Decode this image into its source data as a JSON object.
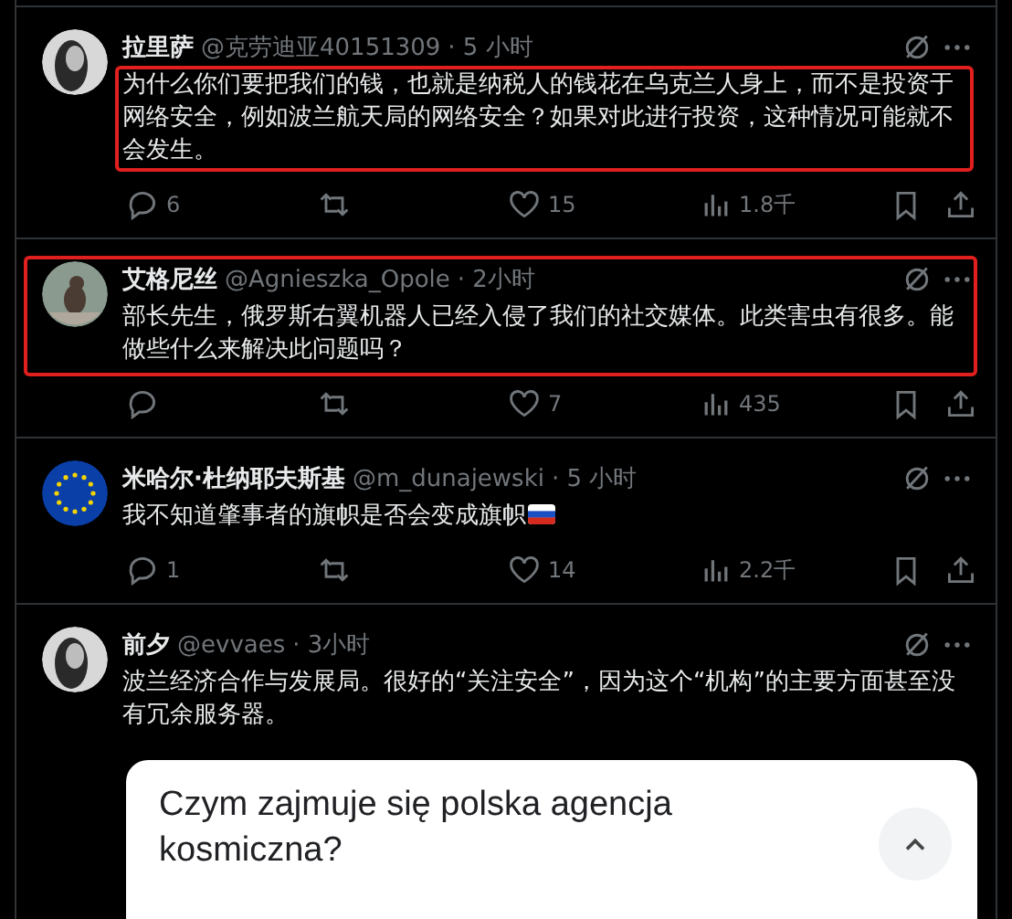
{
  "tweets": [
    {
      "name": "拉里萨",
      "handle": "@克劳迪亚40151309",
      "time": "· 5 小时",
      "text_boxed": true,
      "post_boxed": false,
      "text": "为什么你们要把我们的钱，也就是纳税人的钱花在乌克兰人身上，而不是投资于网络安全，例如波兰航天局的网络安全？如果对此进行投资，这种情况可能就不会发生。",
      "replies": "6",
      "likes": "15",
      "views": "1.8千"
    },
    {
      "name": "艾格尼丝",
      "handle": "@Agnieszka_Opole",
      "time": "· 2小时",
      "text_boxed": false,
      "post_boxed": true,
      "text": "部长先生，俄罗斯右翼机器人已经入侵了我们的社交媒体。此类害虫有很多。能做些什么来解决此问题吗？",
      "likes": "7",
      "views": "435"
    },
    {
      "name": "米哈尔·杜纳耶夫斯基",
      "handle": "@m_dunajewski",
      "time": "· 5 小时",
      "text_boxed": false,
      "post_boxed": false,
      "text": "我不知道肇事者的旗帜是否会变成旗帜",
      "flag_emoji": true,
      "replies": "1",
      "likes": "14",
      "views": "2.2千"
    },
    {
      "name": "前夕",
      "handle": "@evvaes",
      "time": "· 3小时",
      "text_boxed": false,
      "post_boxed": false,
      "text": "波兰经济合作与发展局。很好的“关注安全”，因为这个“机构”的主要方面甚至没有冗余服务器。",
      "card": {
        "question": "Czym zajmuje się polska agencja kosmiczna?",
        "expanded": true
      }
    }
  ]
}
